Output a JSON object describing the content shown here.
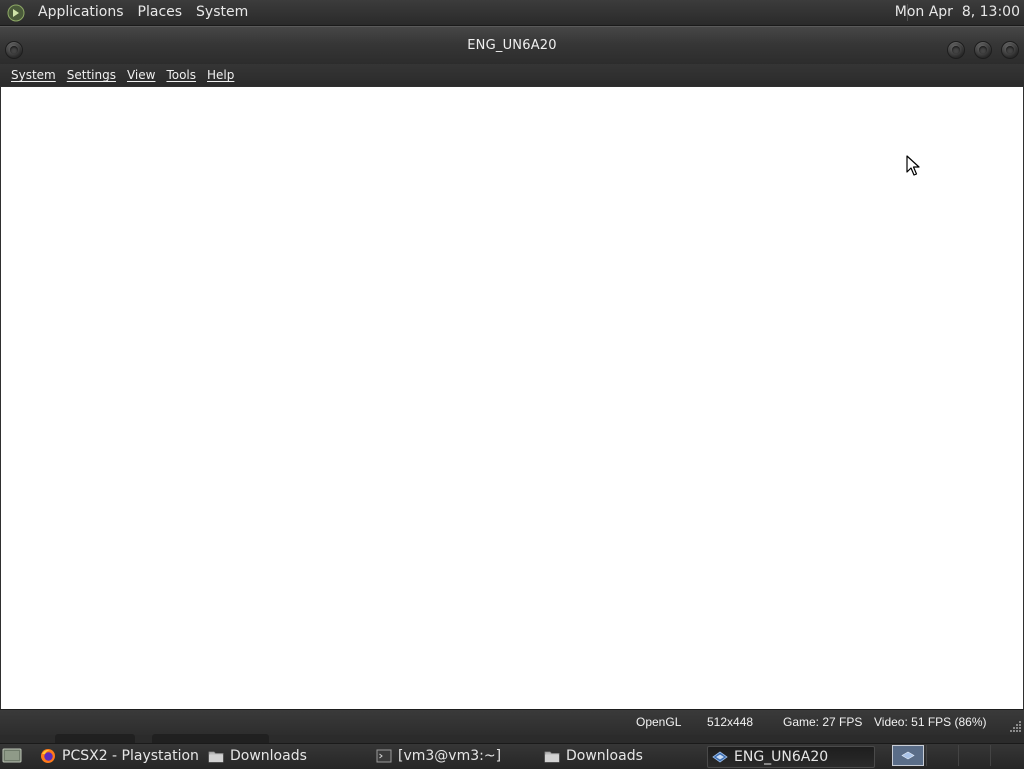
{
  "top_panel": {
    "menus": [
      "Applications",
      "Places",
      "System"
    ],
    "clock": "Mon Apr  8, 13:00"
  },
  "window": {
    "title": "ENG_UN6A20",
    "menubar": [
      "System",
      "Settings",
      "View",
      "Tools",
      "Help"
    ],
    "statusbar": {
      "renderer": "OpenGL",
      "resolution": "512x448",
      "game_fps": "Game: 27 FPS",
      "video_fps": "Video: 51 FPS (86%)"
    }
  },
  "taskbar": {
    "tasks": [
      {
        "label": "PCSX2 - Playstation ...",
        "icon": "firefox-icon"
      },
      {
        "label": "Downloads",
        "icon": "folder-icon"
      },
      {
        "label": "[vm3@vm3:~]",
        "icon": "terminal-icon"
      },
      {
        "label": "Downloads",
        "icon": "folder-icon"
      },
      {
        "label": "ENG_UN6A20",
        "icon": "pcsx2-icon",
        "active": true
      }
    ]
  },
  "colors": {
    "panel_bg": "#2a2a2a",
    "render_bg": "#ffffff",
    "workspace_active": "#5a6d88"
  }
}
